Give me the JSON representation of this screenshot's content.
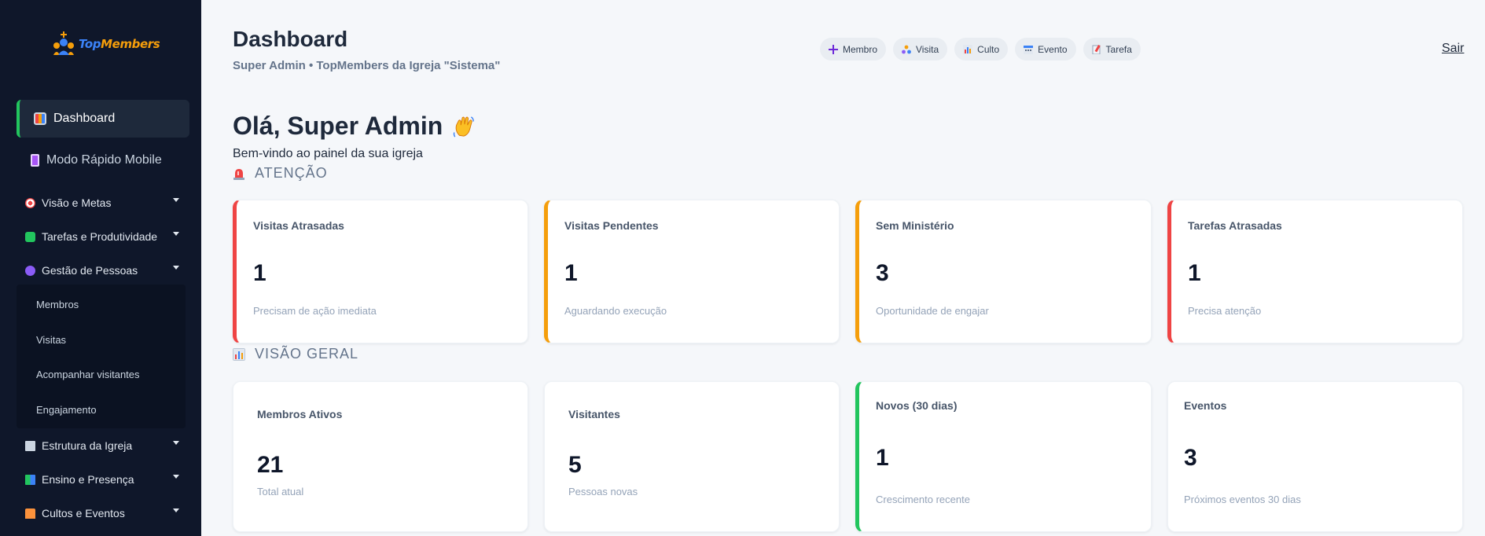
{
  "app": {
    "logo_text_a": "Top",
    "logo_text_b": "Members"
  },
  "sidebar": {
    "dashboard": "Dashboard",
    "quick_mode": "Modo Rápido Mobile",
    "groups": [
      {
        "label": "Visão e Metas"
      },
      {
        "label": "Tarefas e Produtividade"
      },
      {
        "label": "Gestão de Pessoas"
      },
      {
        "label": "Estrutura da Igreja"
      },
      {
        "label": "Ensino e Presença"
      },
      {
        "label": "Cultos e Eventos"
      }
    ],
    "submenu": [
      "Membros",
      "Visitas",
      "Acompanhar visitantes",
      "Engajamento"
    ]
  },
  "header": {
    "title": "Dashboard",
    "subtitle": "Super Admin • TopMembers da Igreja \"Sistema\"",
    "actions": [
      "Membro",
      "Visita",
      "Culto",
      "Evento",
      "Tarefa"
    ],
    "logout": "Sair"
  },
  "greeting": {
    "title": "Olá, Super Admin",
    "welcome": "Bem-vindo ao painel da sua igreja"
  },
  "attention": {
    "heading": "ATENÇÃO",
    "cards": [
      {
        "label": "Visitas Atrasadas",
        "value": "1",
        "note": "Precisam de ação imediata"
      },
      {
        "label": "Visitas Pendentes",
        "value": "1",
        "note": "Aguardando execução"
      },
      {
        "label": "Sem Ministério",
        "value": "3",
        "note": "Oportunidade de engajar"
      },
      {
        "label": "Tarefas Atrasadas",
        "value": "1",
        "note": "Precisa atenção"
      }
    ]
  },
  "overview": {
    "heading": "VISÃO GERAL",
    "cards": [
      {
        "label": "Membros Ativos",
        "value": "21",
        "note": "Total atual"
      },
      {
        "label": "Visitantes",
        "value": "5",
        "note": "Pessoas novas"
      },
      {
        "label": "Novos (30 dias)",
        "value": "1",
        "note": "Crescimento recente"
      },
      {
        "label": "Eventos",
        "value": "3",
        "note": "Próximos eventos 30 dias"
      }
    ]
  },
  "colors": {
    "red": "#ef4444",
    "orange": "#f59e0b",
    "green": "#22c55e",
    "sidebar": "#0f172a"
  }
}
